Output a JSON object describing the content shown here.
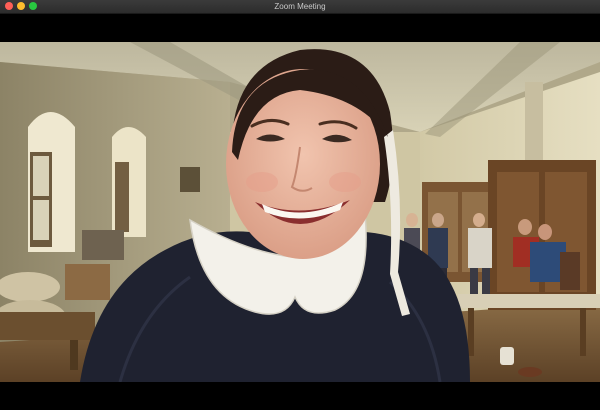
{
  "window": {
    "title": "Zoom Meeting"
  },
  "colors": {
    "titlebar": "#2e2e2e",
    "close": "#fe5f57",
    "minimize": "#febc2e",
    "maximize": "#28c840",
    "background": "#000000"
  },
  "video": {
    "icon": "virtual-background-painting"
  }
}
